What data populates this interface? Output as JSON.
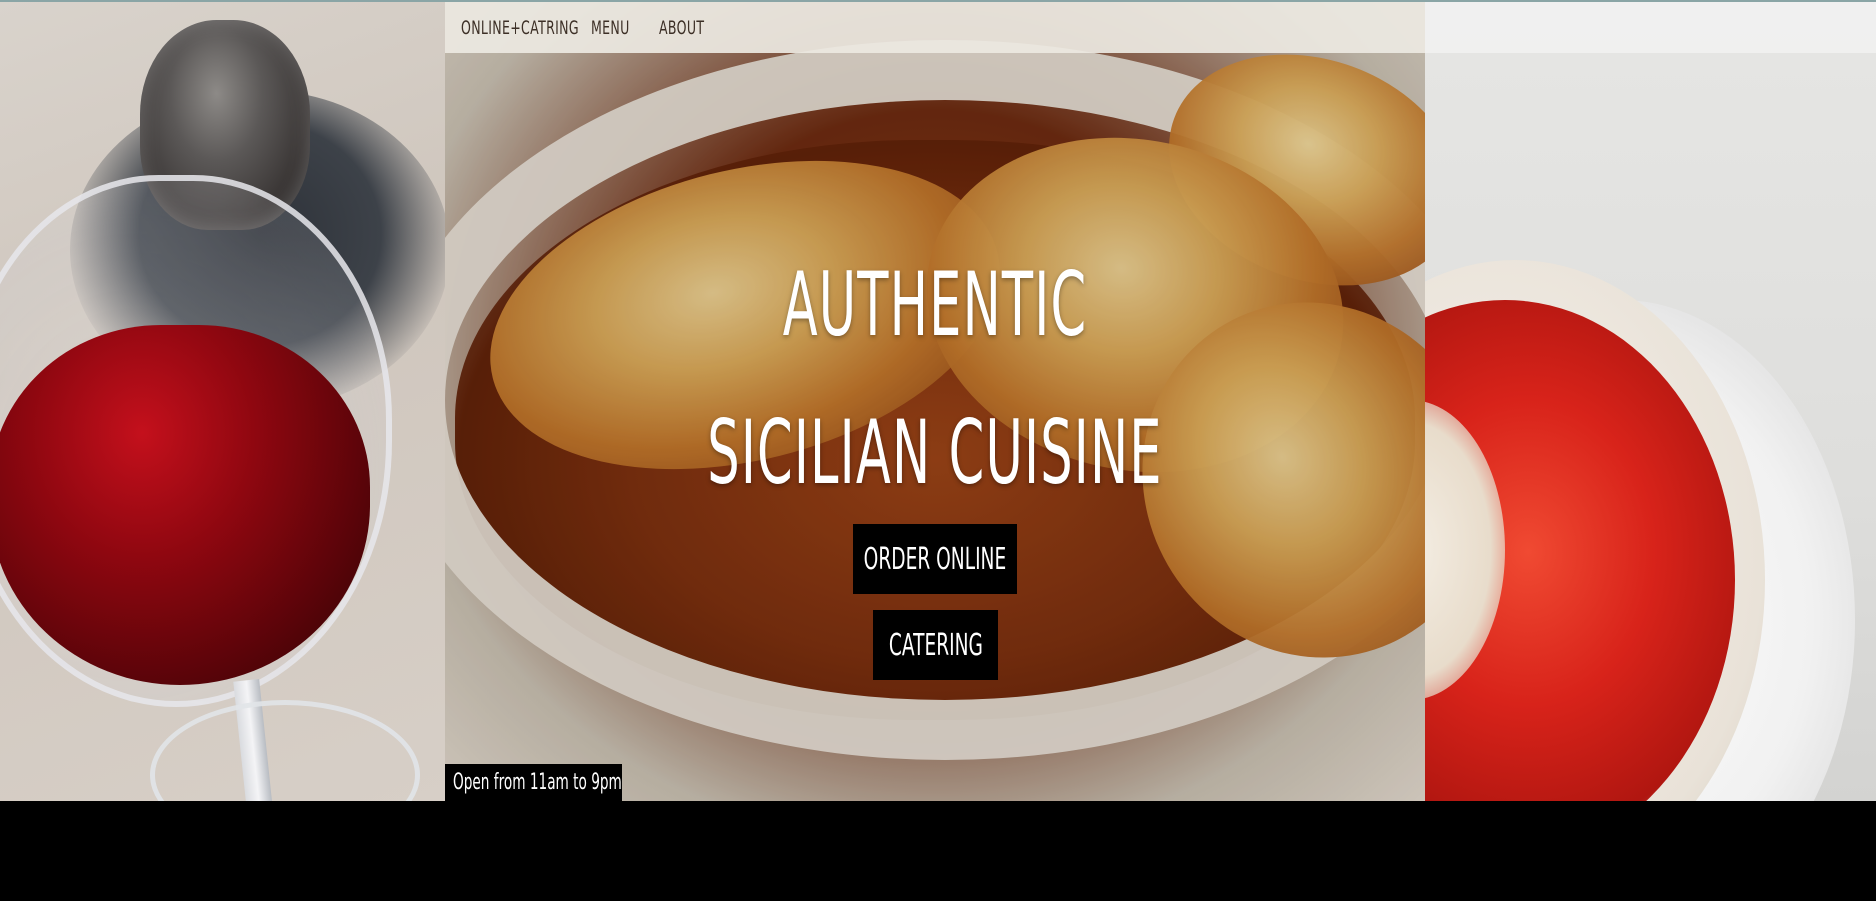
{
  "nav": {
    "items": [
      {
        "label": "ONLINE+CATRING"
      },
      {
        "label": "MENU"
      },
      {
        "label": "ABOUT"
      }
    ]
  },
  "hero": {
    "headline_line1": "AUTHENTIC",
    "headline_line2": "SICILIAN CUISINE",
    "buttons": {
      "order_online": "ORDER ONLINE",
      "catering": "CATERING"
    },
    "hours": "Open from 11am to 9pm"
  },
  "colors": {
    "button_bg": "#000000",
    "button_text": "#ffffff",
    "nav_text": "#3c2f26",
    "accent_border": "#8aa5a6"
  },
  "images": {
    "left": "wine-glass-photo",
    "center": "baked-dish-photo",
    "right": "pasta-bowl-photo"
  }
}
